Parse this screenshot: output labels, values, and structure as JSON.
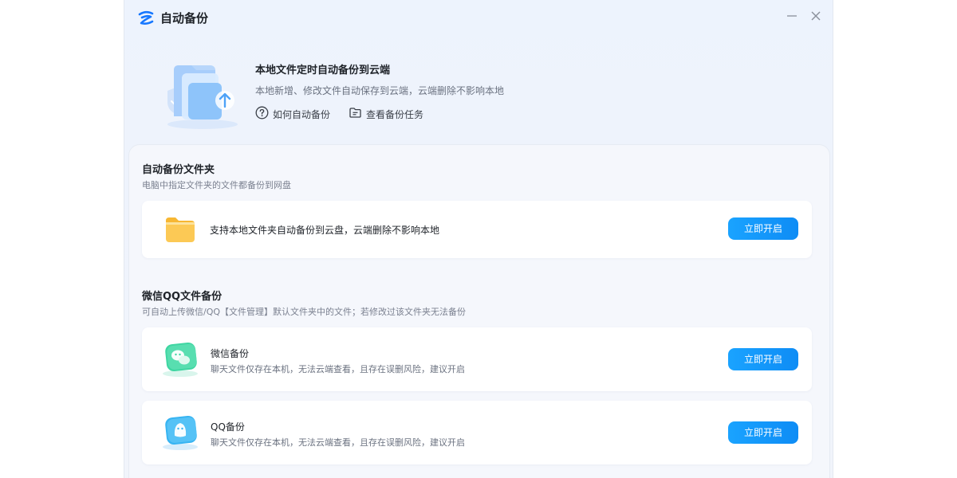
{
  "window": {
    "title": "自动备份"
  },
  "hero": {
    "title": "本地文件定时自动备份到云端",
    "subtitle": "本地新增、修改文件自动保存到云端，云端删除不影响本地",
    "link_how": "如何自动备份",
    "link_tasks": "查看备份任务"
  },
  "folder_section": {
    "title": "自动备份文件夹",
    "description": "电脑中指定文件夹的文件都备份到网盘",
    "card_text": "支持本地文件夹自动备份到云盘，云端删除不影响本地",
    "button": "立即开启"
  },
  "im_section": {
    "title": "微信QQ文件备份",
    "description": "可自动上传微信/QQ【文件管理】默认文件夹中的文件；若修改过该文件夹无法备份",
    "items": [
      {
        "title": "微信备份",
        "description": "聊天文件仅存在本机，无法云端查看，且存在误删风险，建议开启",
        "button": "立即开启",
        "icon": "wechat-icon"
      },
      {
        "title": "QQ备份",
        "description": "聊天文件仅存在本机，无法云端查看，且存在误删风险，建议开启",
        "button": "立即开启",
        "icon": "qq-icon"
      }
    ]
  },
  "colors": {
    "accent": "#0e8cf5",
    "folder": "#fbc54d",
    "wechat": "#3fd6a2",
    "qq": "#37b4f2"
  }
}
